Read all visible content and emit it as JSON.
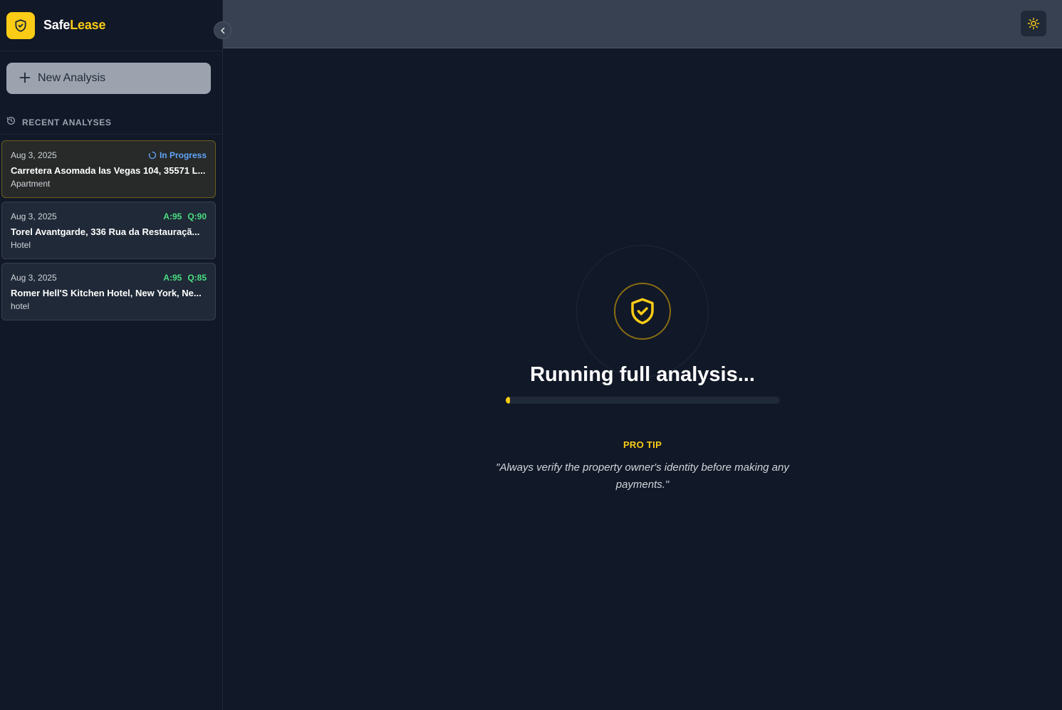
{
  "brand": {
    "name_part1": "Safe",
    "name_part2": "Lease"
  },
  "sidebar": {
    "new_button_label": "New Analysis",
    "recent_heading": "RECENT ANALYSES",
    "items": [
      {
        "date": "Aug 3, 2025",
        "status": "In Progress",
        "title": "Carretera Asomada las Vegas 104, 35571 L...",
        "type": "Apartment"
      },
      {
        "date": "Aug 3, 2025",
        "score_a": "A:95",
        "score_q": "Q:90",
        "title": "Torel Avantgarde, 336 Rua da Restauraçã...",
        "type": "Hotel"
      },
      {
        "date": "Aug 3, 2025",
        "score_a": "A:95",
        "score_q": "Q:85",
        "title": "Romer Hell'S Kitchen Hotel, New York, Ne...",
        "type": "hotel"
      }
    ]
  },
  "main": {
    "status_title": "Running full analysis...",
    "progress": 0.015,
    "tip_label": "PRO TIP",
    "tip_text": "\"Always verify the property owner's identity before making any payments.\""
  },
  "colors": {
    "accent": "#facc15",
    "in_progress": "#60a5fa",
    "score": "#4ade80",
    "background": "#111827"
  },
  "icons": {
    "logo": "shield-icon",
    "collapse": "chevron-left-icon",
    "new": "plus-icon",
    "recent": "history-icon",
    "status": "spinner-icon",
    "theme": "sun-icon",
    "hero": "shield-check-icon"
  }
}
